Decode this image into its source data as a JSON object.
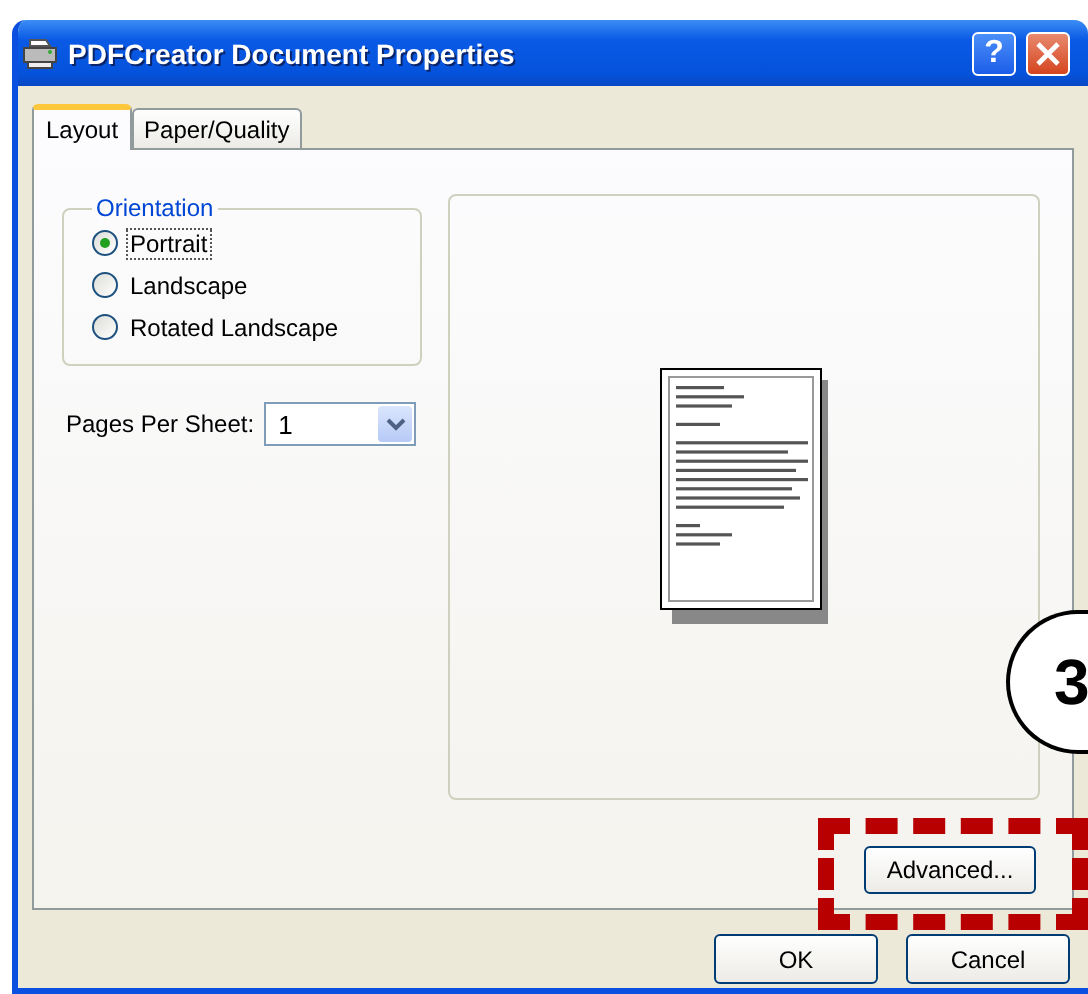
{
  "window": {
    "title": "PDFCreator Document Properties",
    "help_label": "?"
  },
  "tabs": [
    {
      "label": "Layout",
      "selected": true
    },
    {
      "label": "Paper/Quality",
      "selected": false
    }
  ],
  "orientation": {
    "legend": "Orientation",
    "options": [
      {
        "label": "Portrait",
        "selected": true
      },
      {
        "label": "Landscape",
        "selected": false
      },
      {
        "label": "Rotated Landscape",
        "selected": false
      }
    ]
  },
  "pages_per_sheet": {
    "label": "Pages Per Sheet:",
    "value": "1"
  },
  "advanced_button": "Advanced...",
  "buttons": [
    "OK",
    "Cancel"
  ],
  "callout": {
    "number": "3"
  }
}
